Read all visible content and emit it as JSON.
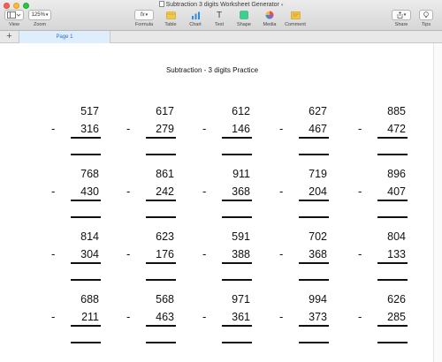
{
  "window": {
    "title": "Subtraction 3 digits Worksheet Generator"
  },
  "toolbar": {
    "view_label": "View",
    "zoom_value": "125%",
    "zoom_label": "Zoom",
    "formula_glyph": "fx",
    "formula_label": "Formula",
    "table_label": "Table",
    "chart_label": "Chart",
    "text_glyph": "T",
    "text_label": "Text",
    "shape_label": "Shape",
    "media_label": "Media",
    "comment_label": "Comment",
    "share_label": "Share",
    "tips_label": "Tips"
  },
  "tabs": {
    "add_glyph": "+",
    "page_label": "Page 1"
  },
  "document": {
    "title": "Subtraction - 3 digits  Practice",
    "minus_sign": "-",
    "problems": [
      {
        "top": "517",
        "bottom": "316"
      },
      {
        "top": "617",
        "bottom": "279"
      },
      {
        "top": "612",
        "bottom": "146"
      },
      {
        "top": "627",
        "bottom": "467"
      },
      {
        "top": "885",
        "bottom": "472"
      },
      {
        "top": "768",
        "bottom": "430"
      },
      {
        "top": "861",
        "bottom": "242"
      },
      {
        "top": "911",
        "bottom": "368"
      },
      {
        "top": "719",
        "bottom": "204"
      },
      {
        "top": "896",
        "bottom": "407"
      },
      {
        "top": "814",
        "bottom": "304"
      },
      {
        "top": "623",
        "bottom": "176"
      },
      {
        "top": "591",
        "bottom": "388"
      },
      {
        "top": "702",
        "bottom": "368"
      },
      {
        "top": "804",
        "bottom": "133"
      },
      {
        "top": "688",
        "bottom": "211"
      },
      {
        "top": "568",
        "bottom": "463"
      },
      {
        "top": "971",
        "bottom": "361"
      },
      {
        "top": "994",
        "bottom": "373"
      },
      {
        "top": "626",
        "bottom": "285"
      }
    ]
  },
  "colors": {
    "accent": "#2d6fc9",
    "tab_active_bg": "#dfeefc",
    "table_icon": "#f2c84b",
    "shape_icon": "#3ccf8e",
    "comment_icon": "#f4c542"
  }
}
